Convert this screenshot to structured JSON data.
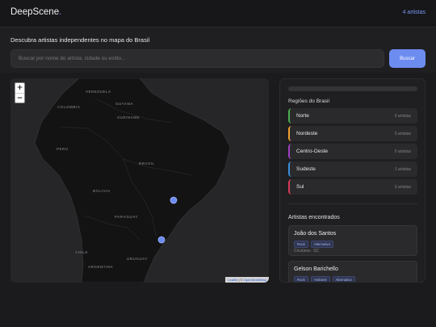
{
  "header": {
    "logo": "DeepScene",
    "logo_dot": ".",
    "artist_count": "4 artistas"
  },
  "search": {
    "intro": "Descubra artistas independentes no mapa do Brasil",
    "placeholder": "Buscar por nome do artista, cidade ou estilo...",
    "button_label": "Buscar"
  },
  "map": {
    "zoom_in": "+",
    "zoom_out": "−",
    "countries": [
      "VENEZUELA",
      "GUYANA",
      "COLOMBIA",
      "SURINAME",
      "PERU",
      "BRASIL",
      "BOLIVIA",
      "PARAGUAY",
      "URUGUAY",
      "CHILE",
      "ARGENTINA"
    ],
    "attribution_leaflet": "Leaflet",
    "attribution_sep": " | © ",
    "attribution_osm": "OpenStreetMap",
    "marker_color": "#6d8cf0"
  },
  "panel": {
    "regions_title": "Regiões do Brasil",
    "regions": [
      {
        "name": "Norte",
        "count": "0 artistas",
        "color": "#4caf50"
      },
      {
        "name": "Nordeste",
        "count": "0 artistas",
        "color": "#f0a030"
      },
      {
        "name": "Centro-Oeste",
        "count": "0 artistas",
        "color": "#a040c0"
      },
      {
        "name": "Sudeste",
        "count": "1 artistas",
        "color": "#3a8fd8"
      },
      {
        "name": "Sul",
        "count": "3 artistas",
        "color": "#d83a5a"
      }
    ],
    "found_title": "Artistas encontrados",
    "artists": [
      {
        "name": "João dos Santos",
        "tags": [
          "Rock",
          "Alternativo"
        ],
        "location": "Criciúma - SC"
      },
      {
        "name": "Gelson Barichello",
        "tags": [
          "Rock",
          "Ambient",
          "Alternativo"
        ],
        "location": ""
      }
    ]
  }
}
